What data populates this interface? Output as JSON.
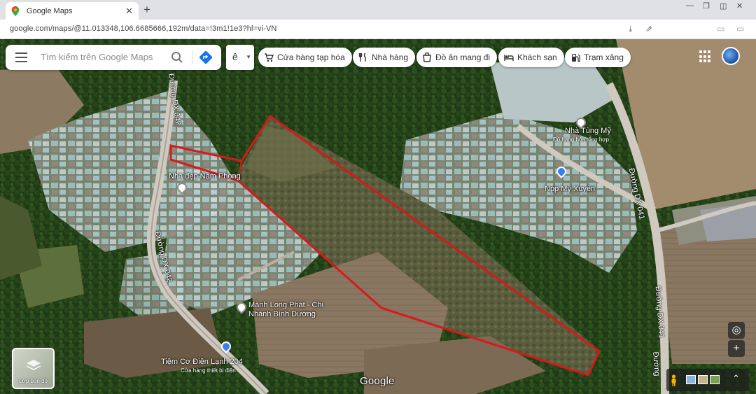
{
  "browser": {
    "tab_title": "Google Maps",
    "url": "google.com/maps/@11.013348,106.6685666,192m/data=!3m1!1e3?hl=vi-VN"
  },
  "search": {
    "placeholder": "Tìm kiếm trên Google Maps",
    "lang_value": "ê"
  },
  "chips": [
    {
      "label": "Cửa hàng tạp hóa",
      "icon": "cart-icon"
    },
    {
      "label": "Nhà hàng",
      "icon": "fork-knife-icon"
    },
    {
      "label": "Đồ ăn mang đi",
      "icon": "takeout-bag-icon"
    },
    {
      "label": "Khách sạn",
      "icon": "bed-icon"
    },
    {
      "label": "Trạm xăng",
      "icon": "gas-pump-icon"
    }
  ],
  "map": {
    "roads": [
      {
        "name": "Đường DX 042"
      },
      {
        "name": "Đường DX 042"
      },
      {
        "name": "Đường DX 041"
      },
      {
        "name": "Đường DX 041"
      },
      {
        "name": "Đường"
      }
    ],
    "pois": [
      {
        "name": "Nhà Tùng Mỹ",
        "sub": "Đồ hàng hóa tổng hợp"
      },
      {
        "name": "Npp Mỹ Xuyên"
      },
      {
        "name": "Nhà đẹp Nam Phong"
      },
      {
        "name": "Mành Long Phát - Chi Nhánh Bình Dương"
      },
      {
        "name": "Tiệm Cơ Điện Lạnh 204",
        "sub": "Cửa hàng thiết bị điện"
      }
    ],
    "attribution": "Google",
    "layers_label": "Lớp bản đồ",
    "highlight_color": "#d7191c"
  }
}
